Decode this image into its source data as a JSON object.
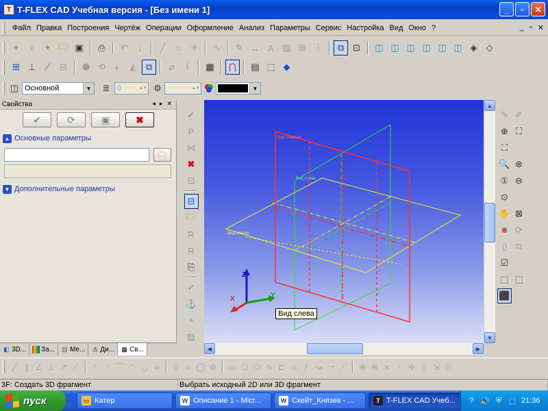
{
  "window": {
    "title": "T-FLEX CAD Учебная версия - [Без имени 1]",
    "icon": "tflex-app-icon",
    "controls": {
      "minimize": "_",
      "maximize": "▫",
      "close": "✕"
    }
  },
  "menu": {
    "items": [
      "Файл",
      "Правка",
      "Построения",
      "Чертёж",
      "Операции",
      "Оформление",
      "Анализ",
      "Параметры",
      "Сервис",
      "Настройка",
      "Вид",
      "Окно",
      "?"
    ],
    "mdi_controls": [
      "_",
      "▫",
      "✕"
    ]
  },
  "props_bar": {
    "layer": "Основной",
    "line_width": "0",
    "color_value": "#000000"
  },
  "panel": {
    "title": "Свойства",
    "header_controls": [
      "◂",
      "▸",
      "✕"
    ],
    "section_main": "Основные параметры",
    "section_extra": "Дополнительные параметры",
    "input_value": "",
    "tabs": [
      {
        "icon": "3d-model-icon",
        "label": "3D..."
      },
      {
        "icon": "rainbow-icon",
        "label": "За..."
      },
      {
        "icon": "menu-icon",
        "label": "Ме..."
      },
      {
        "icon": "warning-icon",
        "label": "Ди..."
      },
      {
        "icon": "properties-icon",
        "label": "Св..."
      }
    ]
  },
  "viewport": {
    "tooltip": "Вид слева",
    "plane_labels": [
      "Вид спереди",
      "Вид слева",
      "Вид сверху"
    ],
    "axes": {
      "x": "X",
      "y": "Y",
      "z": "Z"
    },
    "colors": {
      "front": "#ff3030",
      "left": "#30e030",
      "top": "#f0f020"
    }
  },
  "status": {
    "command": "3F: Создать 3D фрагмент",
    "prompt": "Выбрать исходный 2D или 3D фрагмент"
  },
  "taskbar": {
    "start_label": "пуск",
    "tasks": [
      {
        "icon": "folder-icon",
        "label": "Катер",
        "active": false
      },
      {
        "icon": "word-icon",
        "label": "Описание 1 - Micr...",
        "active": false
      },
      {
        "icon": "word-icon",
        "label": "Скейт_Князев - ...",
        "active": false
      },
      {
        "icon": "tflex-icon",
        "label": "T-FLEX CAD Учеб...",
        "active": true
      }
    ],
    "lang": "RU",
    "time": "21:36"
  }
}
